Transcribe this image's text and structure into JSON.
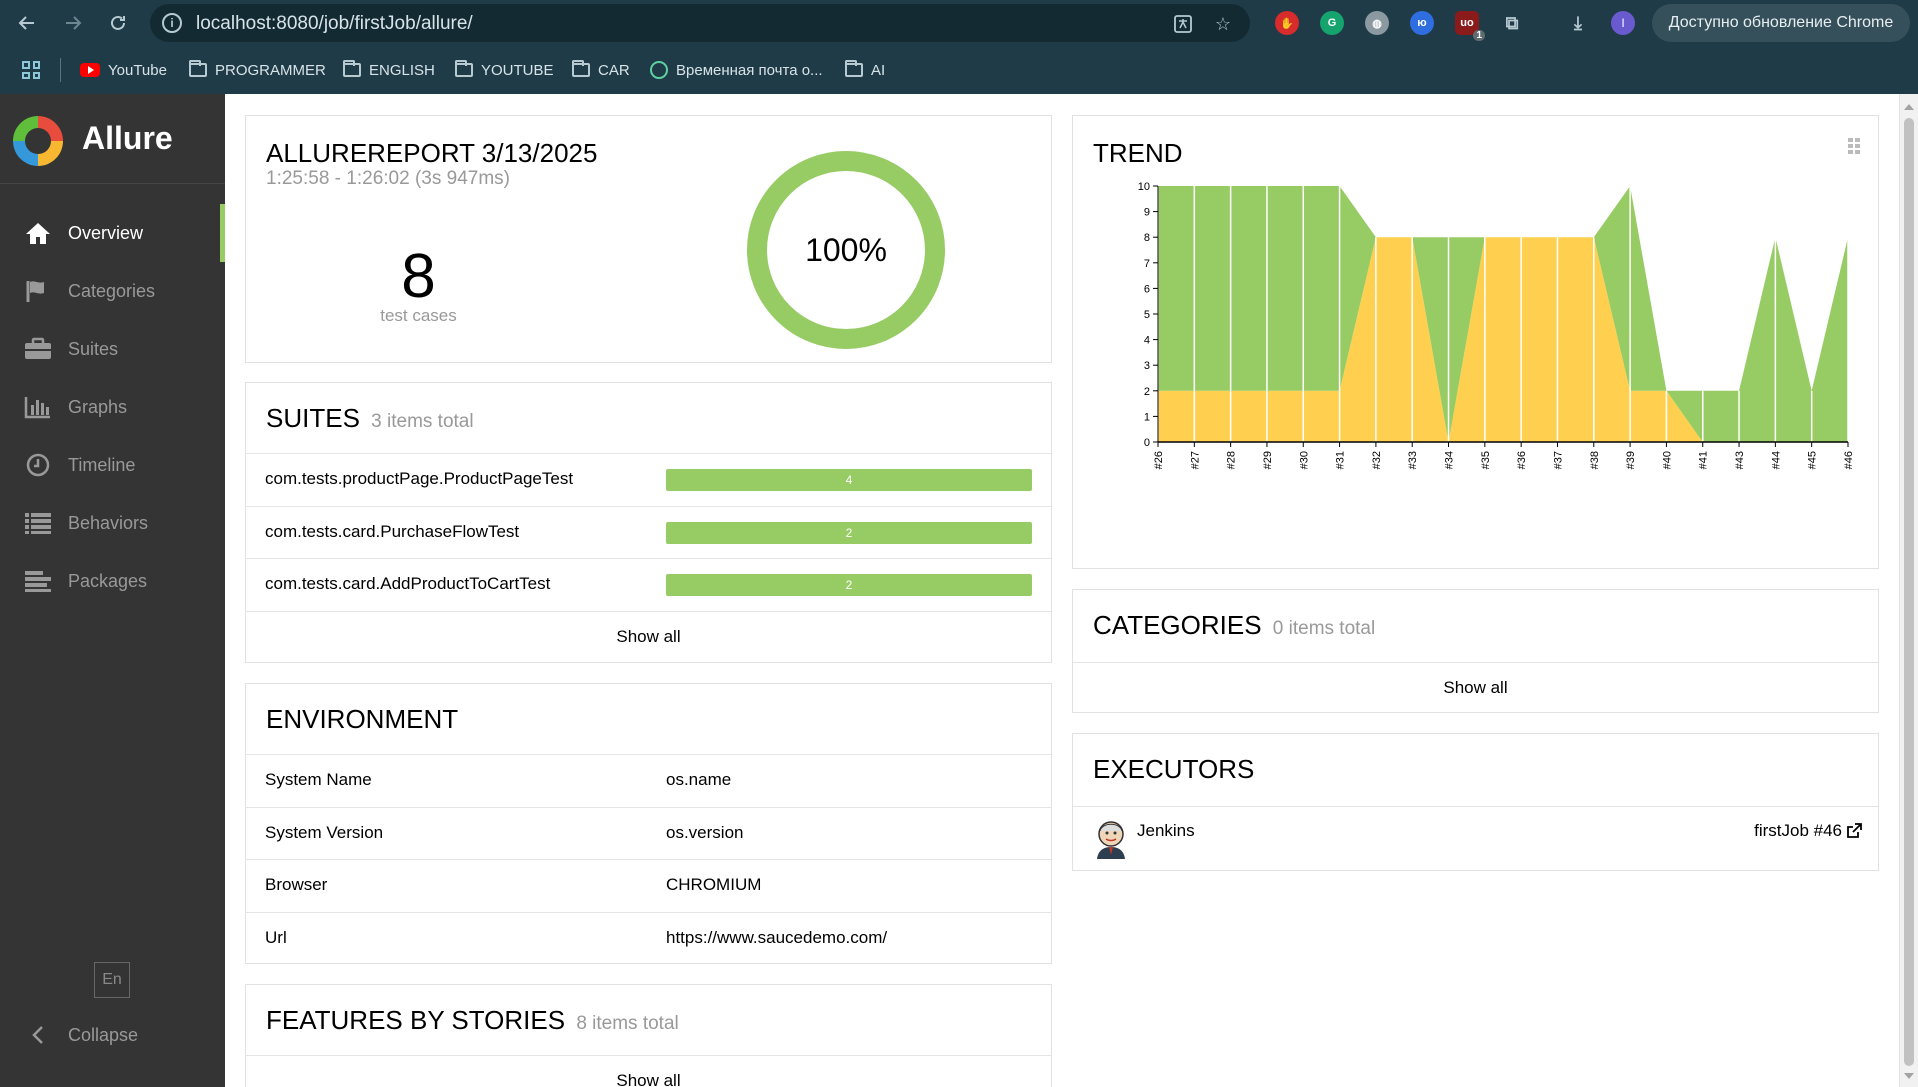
{
  "browser": {
    "url": "localhost:8080/job/firstJob/allure/",
    "update_label": "Доступно обновление Chrome",
    "profile_initial": "I",
    "extension_badge": "1",
    "bookmarks": [
      "YouTube",
      "PROGRAMMER",
      "ENGLISH",
      "YOUTUBE",
      "CAR",
      "Временная почта о...",
      "AI"
    ]
  },
  "sidebar": {
    "brand": "Allure",
    "items": [
      {
        "label": "Overview",
        "icon": "home-icon"
      },
      {
        "label": "Categories",
        "icon": "flag-icon"
      },
      {
        "label": "Suites",
        "icon": "briefcase-icon"
      },
      {
        "label": "Graphs",
        "icon": "bar-chart-icon"
      },
      {
        "label": "Timeline",
        "icon": "clock-icon"
      },
      {
        "label": "Behaviors",
        "icon": "list-icon"
      },
      {
        "label": "Packages",
        "icon": "align-left-icon"
      }
    ],
    "language": "En",
    "collapse": "Collapse",
    "accent": "#97cc64"
  },
  "summary": {
    "title": "ALLUREREPORT 3/13/2025",
    "time_range": "1:25:58 - 1:26:02 (3s 947ms)",
    "test_count": "8",
    "test_label": "test cases",
    "success_rate": "100%",
    "success_fraction": 1.0
  },
  "suites": {
    "title": "SUITES",
    "subtitle": "3 items total",
    "rows": [
      {
        "name": "com.tests.productPage.ProductPageTest",
        "count": "4"
      },
      {
        "name": "com.tests.card.PurchaseFlowTest",
        "count": "2"
      },
      {
        "name": "com.tests.card.AddProductToCartTest",
        "count": "2"
      }
    ],
    "show_all": "Show all"
  },
  "environment": {
    "title": "ENVIRONMENT",
    "rows": [
      {
        "key": "System Name",
        "value": "os.name"
      },
      {
        "key": "System Version",
        "value": "os.version"
      },
      {
        "key": "Browser",
        "value": "CHROMIUM"
      },
      {
        "key": "Url",
        "value": "https://www.saucedemo.com/"
      }
    ]
  },
  "features": {
    "title": "FEATURES BY STORIES",
    "subtitle": "8 items total",
    "show_all": "Show all"
  },
  "trend": {
    "title": "TREND"
  },
  "categories": {
    "title": "CATEGORIES",
    "subtitle": "0 items total",
    "show_all": "Show all"
  },
  "executors": {
    "title": "EXECUTORS",
    "name": "Jenkins",
    "build": "firstJob #46"
  },
  "chart_data": {
    "type": "area",
    "title": "",
    "categories": [
      "#26",
      "#27",
      "#28",
      "#29",
      "#30",
      "#31",
      "#32",
      "#33",
      "#34",
      "#35",
      "#36",
      "#37",
      "#38",
      "#39",
      "#40",
      "#41",
      "#43",
      "#44",
      "#45",
      "#46"
    ],
    "series": [
      {
        "name": "",
        "color": "#ffd050",
        "values": [
          2,
          2,
          2,
          2,
          2,
          2,
          8,
          8,
          0,
          8,
          8,
          8,
          8,
          2,
          2,
          0,
          0,
          0,
          0,
          0
        ]
      },
      {
        "name": "",
        "color": "#97cc64",
        "values": [
          8,
          8,
          8,
          8,
          8,
          8,
          0,
          0,
          8,
          0,
          0,
          0,
          0,
          8,
          0,
          2,
          2,
          8,
          2,
          8
        ]
      }
    ],
    "stacked": true,
    "ylim": [
      0,
      10
    ],
    "yticks": [
      0,
      1,
      2,
      3,
      4,
      5,
      6,
      7,
      8,
      9,
      10
    ],
    "grid": false,
    "legend": "none"
  }
}
